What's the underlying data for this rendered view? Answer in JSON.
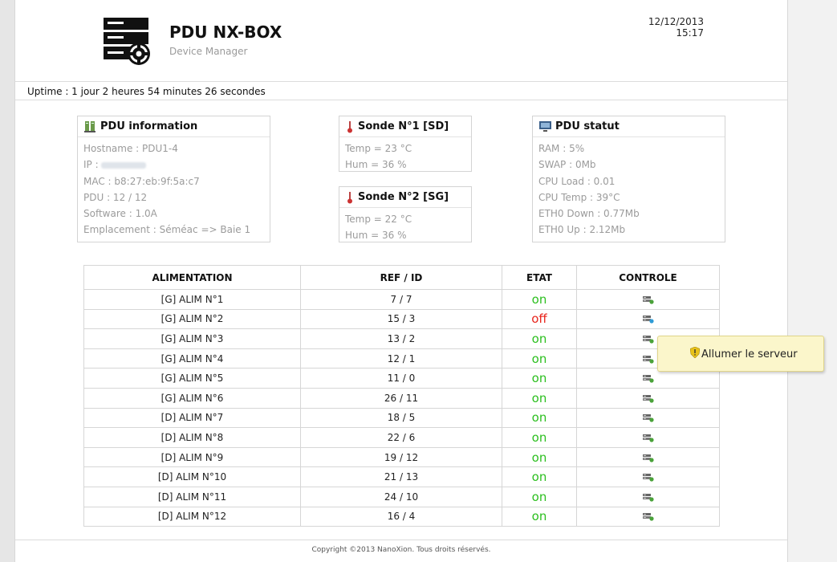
{
  "header": {
    "title": "PDU NX-BOX",
    "subtitle": "Device Manager",
    "date": "12/12/2013",
    "time": "15:17"
  },
  "uptime": "Uptime : 1 jour 2 heures 54 minutes 26 secondes",
  "pdu_info": {
    "title": "PDU information",
    "hostname": "Hostname : PDU1-4",
    "ip_label": "IP :",
    "mac": "MAC : b8:27:eb:9f:5a:c7",
    "pdu": "PDU : 12 / 12",
    "software": "Software : 1.0A",
    "emplacement": "Emplacement : Séméac => Baie 1"
  },
  "sonde1": {
    "title": "Sonde N°1 [SD]",
    "temp": "Temp = 23 °C",
    "hum": "Hum = 36 %"
  },
  "sonde2": {
    "title": "Sonde N°2 [SG]",
    "temp": "Temp = 22 °C",
    "hum": "Hum = 36 %"
  },
  "pdu_statut": {
    "title": "PDU statut",
    "ram": "RAM : 5%",
    "swap": "SWAP : 0Mb",
    "cpu_load": "CPU Load : 0.01",
    "cpu_temp": "CPU Temp : 39°C",
    "eth0_down": "ETH0 Down : 0.77Mb",
    "eth0_up": "ETH0 Up : 2.12Mb"
  },
  "table": {
    "headers": [
      "ALIMENTATION",
      "REF / ID",
      "ETAT",
      "CONTROLE"
    ],
    "rows": [
      {
        "name": "[G] ALIM N°1",
        "ref": "7 / 7",
        "etat": "on"
      },
      {
        "name": "[G] ALIM N°2",
        "ref": "15 / 3",
        "etat": "off"
      },
      {
        "name": "[G] ALIM N°3",
        "ref": "13 / 2",
        "etat": "on"
      },
      {
        "name": "[G] ALIM N°4",
        "ref": "12 / 1",
        "etat": "on"
      },
      {
        "name": "[G] ALIM N°5",
        "ref": "11 / 0",
        "etat": "on"
      },
      {
        "name": "[G] ALIM N°6",
        "ref": "26 / 11",
        "etat": "on"
      },
      {
        "name": "[D] ALIM N°7",
        "ref": "18 / 5",
        "etat": "on"
      },
      {
        "name": "[D] ALIM N°8",
        "ref": "22 / 6",
        "etat": "on"
      },
      {
        "name": "[D] ALIM N°9",
        "ref": "19 / 12",
        "etat": "on"
      },
      {
        "name": "[D] ALIM N°10",
        "ref": "21 / 13",
        "etat": "on"
      },
      {
        "name": "[D] ALIM N°11",
        "ref": "24 / 10",
        "etat": "on"
      },
      {
        "name": "[D] ALIM N°12",
        "ref": "16 / 4",
        "etat": "on"
      }
    ]
  },
  "tooltip": "Allumer le serveur",
  "footer": "Copyright ©2013 NanoXion. Tous droits réservés.",
  "colors": {
    "on": "#2bbf1e",
    "off": "#e8241b",
    "tooltip_bg": "#fbf6cb"
  }
}
